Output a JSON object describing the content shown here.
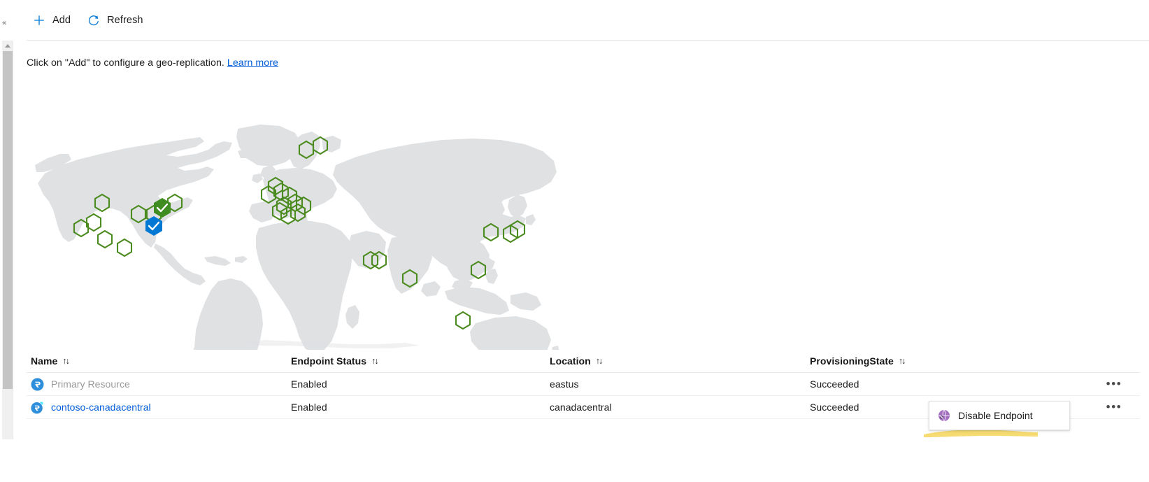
{
  "toolbar": {
    "add_label": "Add",
    "add_icon": "plus-icon",
    "refresh_label": "Refresh",
    "refresh_icon": "refresh-icon"
  },
  "info": {
    "text": "Click on \"Add\" to configure a geo-replication.",
    "link_label": "Learn more"
  },
  "map": {
    "land_color": "#dfe1e3",
    "marker_color": "#4b8b20",
    "primary_marker_color": "#0078d4",
    "replica_marker_color": "#3f8c21"
  },
  "table": {
    "columns": [
      {
        "label": "Name",
        "sort_glyph": "↑↓"
      },
      {
        "label": "Endpoint Status",
        "sort_glyph": "↑↓"
      },
      {
        "label": "Location",
        "sort_glyph": "↑↓"
      },
      {
        "label": "ProvisioningState",
        "sort_glyph": "↑↓"
      }
    ],
    "rows": [
      {
        "name": "Primary Resource",
        "name_state": "disabled",
        "endpoint_status": "Enabled",
        "location": "eastus",
        "provisioning_state": "Succeeded",
        "menu_glyph": "•••"
      },
      {
        "name": "contoso-canadacentral",
        "name_state": "link",
        "endpoint_status": "Enabled",
        "location": "canadacentral",
        "provisioning_state": "Succeeded",
        "menu_glyph": "•••"
      }
    ]
  },
  "context_menu": {
    "items": [
      {
        "label": "Disable Endpoint",
        "icon": "disable-endpoint-icon"
      }
    ]
  },
  "left_rail": {
    "collapse_glyph": "«"
  },
  "colors": {
    "accent_blue": "#0078d4",
    "link_blue": "#015cda",
    "highlighter_yellow": "#f5db71"
  }
}
